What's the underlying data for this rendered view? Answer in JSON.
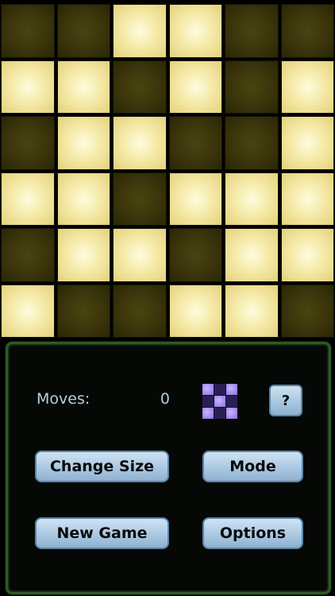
{
  "board": {
    "rows": 6,
    "cols": 6,
    "cells": [
      [
        0,
        0,
        1,
        1,
        0,
        0
      ],
      [
        1,
        1,
        0,
        1,
        0,
        1
      ],
      [
        0,
        1,
        1,
        0,
        0,
        1
      ],
      [
        1,
        1,
        0,
        1,
        1,
        1
      ],
      [
        0,
        1,
        1,
        0,
        1,
        1
      ],
      [
        1,
        0,
        0,
        1,
        1,
        0
      ]
    ],
    "colors": {
      "on": "#f5eba8",
      "off": "#3a350b"
    }
  },
  "panel": {
    "moves_label": "Moves:",
    "moves_value": "0",
    "mode_preview": {
      "icon": "mode-pattern-icon",
      "pattern": [
        [
          1,
          0,
          1
        ],
        [
          0,
          1,
          0
        ],
        [
          1,
          0,
          1
        ]
      ],
      "color": "#8c6fe2"
    },
    "help_label": "?",
    "buttons": {
      "change_size": "Change Size",
      "mode": "Mode",
      "new_game": "New Game",
      "options": "Options"
    }
  }
}
